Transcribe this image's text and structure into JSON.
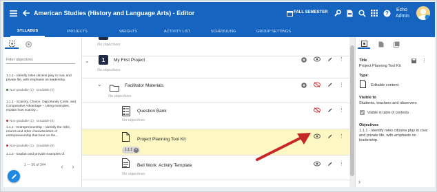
{
  "header": {
    "title": "American Studies (History and Language Arts) - Editor",
    "semester": "FALL SEMESTER",
    "user_name": "Echo",
    "user_role": "Admin"
  },
  "tabs": [
    "SYLLABUS",
    "PROJECTS",
    "WEIGHTS",
    "ACTIVITY LIST",
    "SCHEDULING",
    "GROUP SETTINGS"
  ],
  "left": {
    "filter_placeholder": "Filter objectives",
    "pagination": "1 — 50 of 344",
    "objectives": [
      {
        "text": "1.1.1 - Identify roles citizens play in civic and private life, with emphasis on leadership.",
        "meta": "Non-gradable (1) · Gradable (2)",
        "status_color": "#2e7d32"
      },
      {
        "text": "1.1.1 - Scarcity, Choice, Opportunity Costs, and Comparative Advantage – Using examples, explain how scarcity...",
        "meta": "Non-gradable (1) · Gradable (0)",
        "status_color": "#c62828"
      },
      {
        "text": "1.1.1 - Entrepreneurship – Identify the risks, returns and other characteristics of entrepreneurship that bear on the...",
        "meta": "Non-gradable (1) · Gradable (0)",
        "status_color": "#c62828"
      },
      {
        "text": "1.1.2 - Explain and provide examples of",
        "meta": "",
        "status_color": "#c62828"
      }
    ]
  },
  "center": {
    "top_no_objectives": "No objectives",
    "project": {
      "number": "1",
      "title": "My First Project",
      "no_objectives": "No objectives"
    },
    "folder": {
      "title": "Facilitator Materials",
      "no_objectives": "No objectives"
    },
    "items": [
      {
        "title": "Question Bank",
        "sub": "No objectives"
      },
      {
        "title": "Project Planning Tool Kit",
        "chip": "1.1.1"
      },
      {
        "title": "Bell Work: Activity Template",
        "sub": "No objectives"
      }
    ]
  },
  "right": {
    "title_label": "Title",
    "title_value": "Project Planning Tool Kit",
    "type_label": "Type",
    "type_value": "Editable content",
    "visible_label": "Visible to",
    "visible_value": "Students, teachers and observers",
    "checkbox_label": "Visible in table of contents",
    "objectives_label": "Objectives",
    "objectives_value": "1.1.1 - Identify roles citizens play in civic and private life, with emphasis on leadership."
  },
  "colors": {
    "header": "#1565c0",
    "highlight": "#fdf7c3",
    "arrow": "#c62828"
  }
}
